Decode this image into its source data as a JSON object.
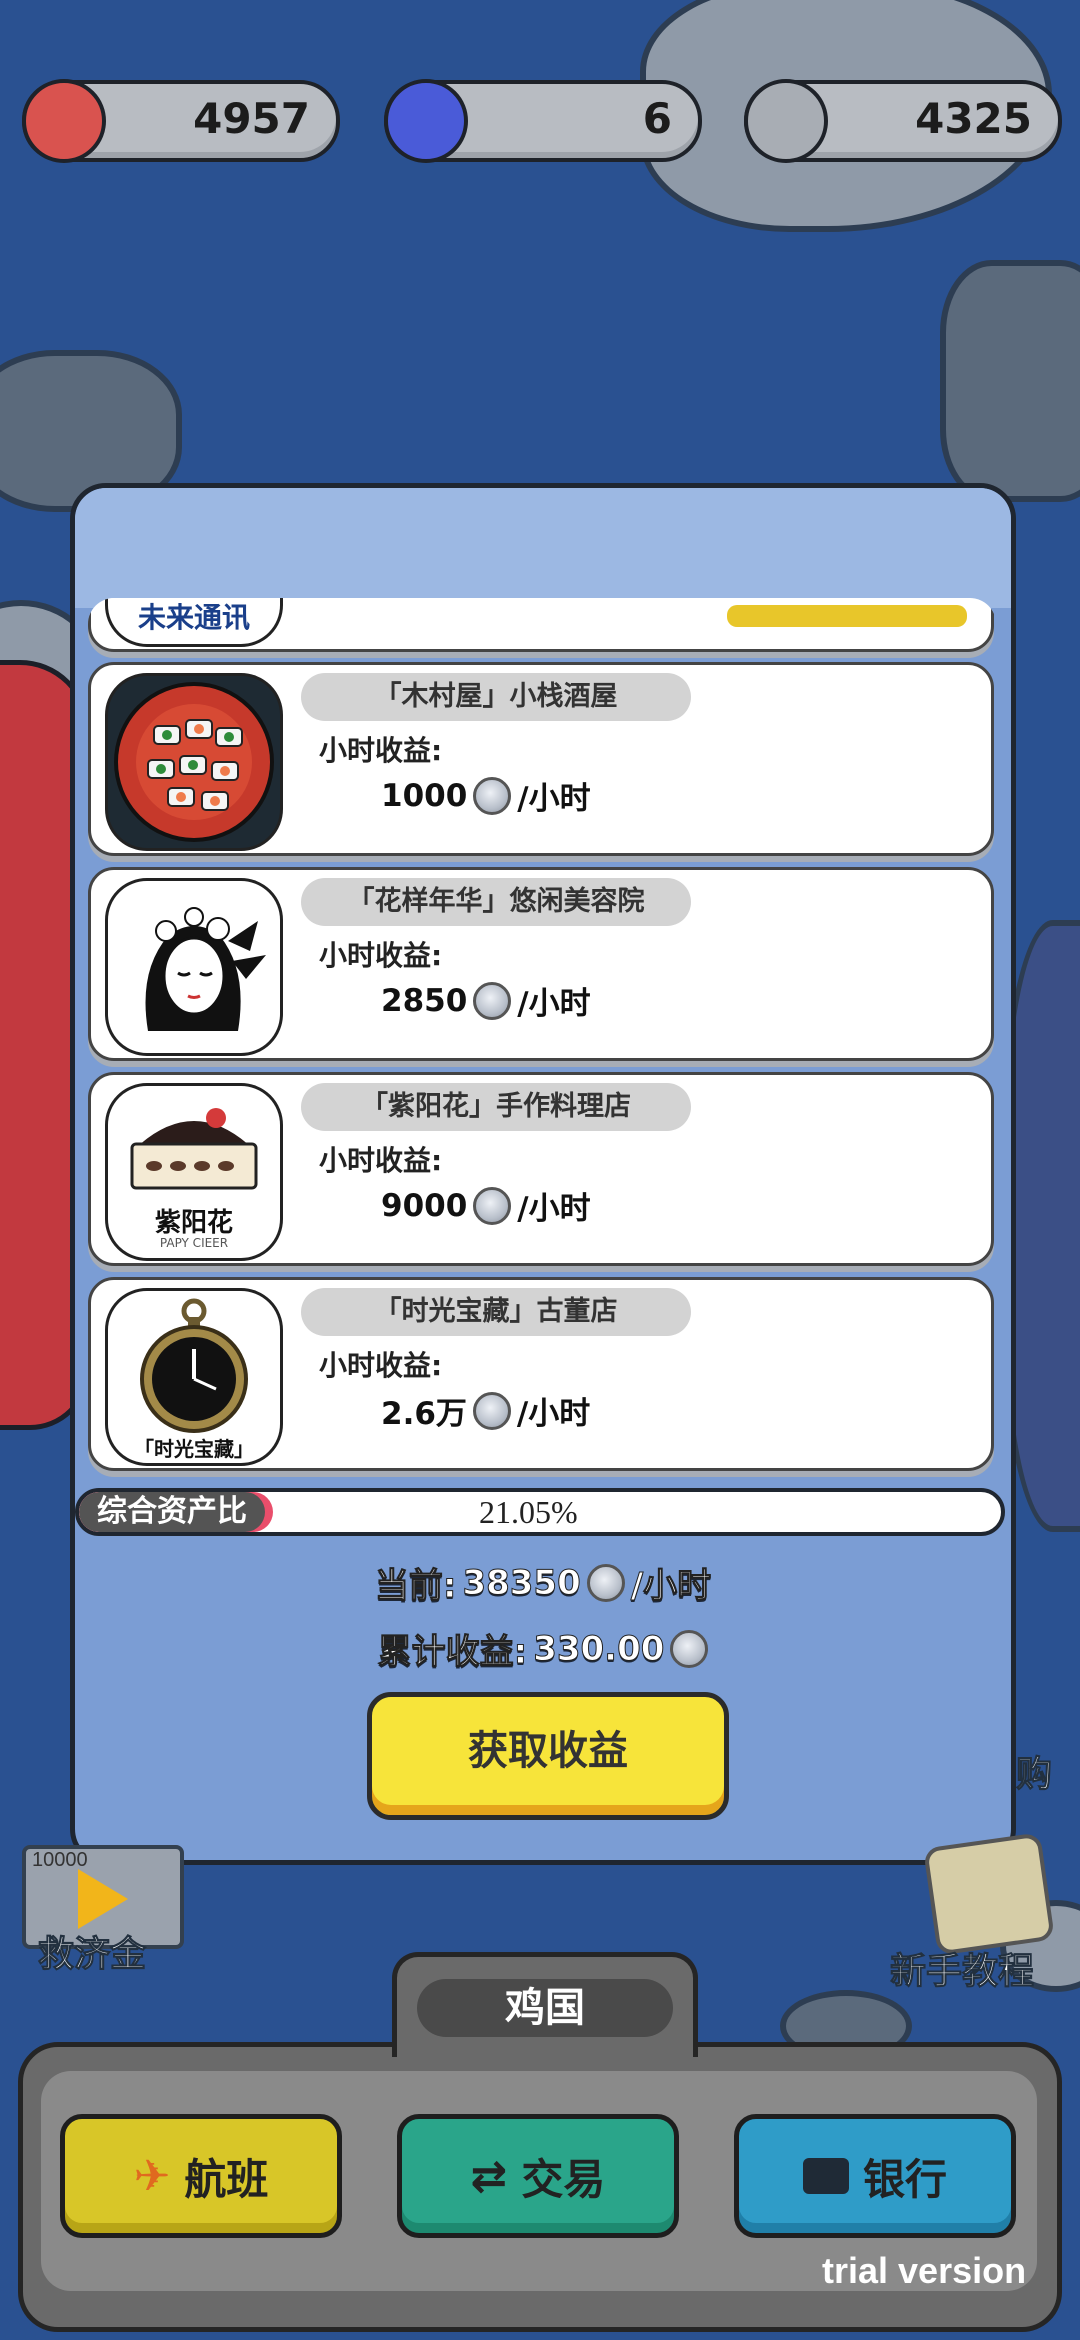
{
  "currencies": [
    {
      "icon": "red-rabbit-coin-icon",
      "value": "4957",
      "color": "#d9534f"
    },
    {
      "icon": "blue-gem-coin-icon",
      "value": "6",
      "color": "#4a5bd8"
    },
    {
      "icon": "silver-coin-icon",
      "value": "4325",
      "color": "#9ea3aa"
    }
  ],
  "shops": [
    {
      "name": "「木村屋」小栈酒屋",
      "income_label": "小时收益:",
      "rate": "1000",
      "unit": "/小时",
      "image": "sushi-plate-icon"
    },
    {
      "name": "「花样年华」悠闲美容院",
      "income_label": "小时收益:",
      "rate": "2850",
      "unit": "/小时",
      "image": "woman-portrait-icon"
    },
    {
      "name": "「紫阳花」手作料理店",
      "income_label": "小时收益:",
      "rate": "9000",
      "unit": "/小时",
      "image": "cake-logo-icon",
      "logo_text": "紫阳花",
      "logo_sub": "PAPY CIEER"
    },
    {
      "name": "「时光宝藏」古董店",
      "income_label": "小时收益:",
      "rate": "2.6万",
      "unit": "/小时",
      "image": "pocket-watch-icon",
      "logo_text": "「时光宝藏」"
    }
  ],
  "progress": {
    "label": "综合资产比",
    "percent": "21.05%",
    "value": 21.05
  },
  "current": {
    "label": "当前:",
    "value": "38350",
    "unit": "/小时"
  },
  "accumulated": {
    "label": "累计收益:",
    "value": "330.00"
  },
  "get_button": "获取收益",
  "relief": {
    "label": "救济金",
    "amount": "10000"
  },
  "tutorial": "新手教程",
  "buy_partial": "购",
  "region": "鸡国",
  "nav": {
    "flight": "航班",
    "trade": "交易",
    "bank": "银行"
  },
  "trial": "trial version",
  "partial_top_logo": "未来通讯"
}
